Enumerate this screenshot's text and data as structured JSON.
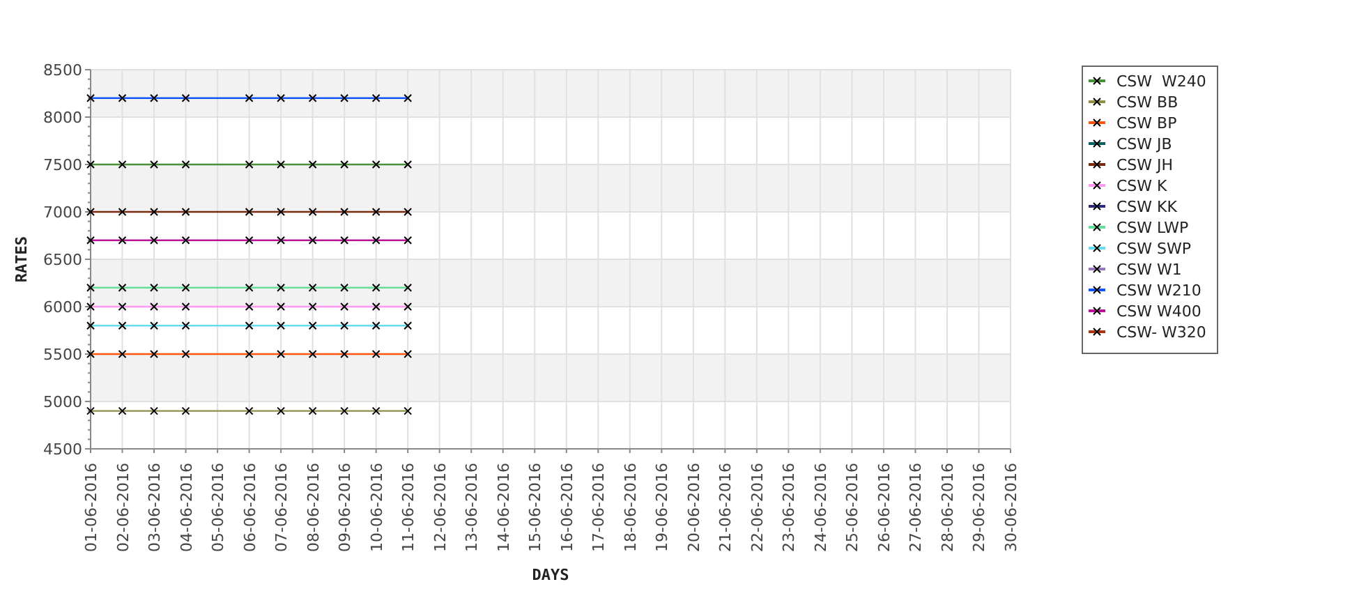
{
  "chart_data": {
    "type": "line",
    "xlabel": "DAYS",
    "ylabel": "RATES",
    "grid": true,
    "legend": true,
    "categories": [
      "01-06-2016",
      "02-06-2016",
      "03-06-2016",
      "04-06-2016",
      "05-06-2016",
      "06-06-2016",
      "07-06-2016",
      "08-06-2016",
      "09-06-2016",
      "10-06-2016",
      "11-06-2016",
      "12-06-2016",
      "13-06-2016",
      "14-06-2016",
      "15-06-2016",
      "16-06-2016",
      "17-06-2016",
      "18-06-2016",
      "19-06-2016",
      "20-06-2016",
      "21-06-2016",
      "22-06-2016",
      "23-06-2016",
      "24-06-2016",
      "25-06-2016",
      "26-06-2016",
      "27-06-2016",
      "28-06-2016",
      "29-06-2016",
      "30-06-2016"
    ],
    "ylim": [
      4500,
      8500
    ],
    "yticks": [
      4500,
      5000,
      5500,
      6000,
      6500,
      7000,
      7500,
      8000,
      8500
    ],
    "series": [
      {
        "name": "CSW  W240",
        "color": "#4a8f3a",
        "marker": "x",
        "values": [
          7500,
          7500,
          7500,
          7500,
          null,
          7500,
          7500,
          7500,
          7500,
          7500,
          7500,
          null,
          null,
          null,
          null,
          null,
          null,
          null,
          null,
          null,
          null,
          null,
          null,
          null,
          null,
          null,
          null,
          null,
          null,
          null
        ]
      },
      {
        "name": "CSW BB",
        "color": "#8f8f4a",
        "marker": "x",
        "values": [
          4900,
          4900,
          4900,
          4900,
          null,
          4900,
          4900,
          4900,
          4900,
          4900,
          4900,
          null,
          null,
          null,
          null,
          null,
          null,
          null,
          null,
          null,
          null,
          null,
          null,
          null,
          null,
          null,
          null,
          null,
          null,
          null
        ]
      },
      {
        "name": "CSW BP",
        "color": "#ff5511",
        "marker": "x",
        "values": [
          5500,
          5500,
          5500,
          5500,
          null,
          5500,
          5500,
          5500,
          5500,
          5500,
          5500,
          null,
          null,
          null,
          null,
          null,
          null,
          null,
          null,
          null,
          null,
          null,
          null,
          null,
          null,
          null,
          null,
          null,
          null,
          null
        ]
      },
      {
        "name": "CSW JB",
        "color": "#0a6060",
        "marker": "x",
        "values": [
          null,
          null,
          null,
          null,
          null,
          null,
          null,
          null,
          null,
          null,
          null,
          null,
          null,
          null,
          null,
          null,
          null,
          null,
          null,
          null,
          null,
          null,
          null,
          null,
          null,
          null,
          null,
          null,
          null,
          null
        ]
      },
      {
        "name": "CSW JH",
        "color": "#7a2a10",
        "marker": "x",
        "values": [
          7000,
          7000,
          7000,
          7000,
          null,
          7000,
          7000,
          7000,
          7000,
          7000,
          7000,
          null,
          null,
          null,
          null,
          null,
          null,
          null,
          null,
          null,
          null,
          null,
          null,
          null,
          null,
          null,
          null,
          null,
          null,
          null
        ]
      },
      {
        "name": "CSW K",
        "color": "#ff99ee",
        "marker": "x",
        "values": [
          6000,
          6000,
          6000,
          6000,
          null,
          6000,
          6000,
          6000,
          6000,
          6000,
          6000,
          null,
          null,
          null,
          null,
          null,
          null,
          null,
          null,
          null,
          null,
          null,
          null,
          null,
          null,
          null,
          null,
          null,
          null,
          null
        ]
      },
      {
        "name": "CSW KK",
        "color": "#2a2a7a",
        "marker": "x",
        "values": [
          null,
          null,
          null,
          null,
          null,
          null,
          null,
          null,
          null,
          null,
          null,
          null,
          null,
          null,
          null,
          null,
          null,
          null,
          null,
          null,
          null,
          null,
          null,
          null,
          null,
          null,
          null,
          null,
          null,
          null
        ]
      },
      {
        "name": "CSW LWP",
        "color": "#66dd99",
        "marker": "x",
        "values": [
          6200,
          6200,
          6200,
          6200,
          null,
          6200,
          6200,
          6200,
          6200,
          6200,
          6200,
          null,
          null,
          null,
          null,
          null,
          null,
          null,
          null,
          null,
          null,
          null,
          null,
          null,
          null,
          null,
          null,
          null,
          null,
          null
        ]
      },
      {
        "name": "CSW SWP",
        "color": "#66ddee",
        "marker": "x",
        "values": [
          5800,
          5800,
          5800,
          5800,
          null,
          5800,
          5800,
          5800,
          5800,
          5800,
          5800,
          null,
          null,
          null,
          null,
          null,
          null,
          null,
          null,
          null,
          null,
          null,
          null,
          null,
          null,
          null,
          null,
          null,
          null,
          null
        ]
      },
      {
        "name": "CSW W1",
        "color": "#9977bb",
        "marker": "x",
        "values": [
          null,
          null,
          null,
          null,
          null,
          null,
          null,
          null,
          null,
          null,
          null,
          null,
          null,
          null,
          null,
          null,
          null,
          null,
          null,
          null,
          null,
          null,
          null,
          null,
          null,
          null,
          null,
          null,
          null,
          null
        ]
      },
      {
        "name": "CSW W210",
        "color": "#1155ff",
        "marker": "x",
        "values": [
          8200,
          8200,
          8200,
          8200,
          null,
          8200,
          8200,
          8200,
          8200,
          8200,
          8200,
          null,
          null,
          null,
          null,
          null,
          null,
          null,
          null,
          null,
          null,
          null,
          null,
          null,
          null,
          null,
          null,
          null,
          null,
          null
        ]
      },
      {
        "name": "CSW W400",
        "color": "#bb1199",
        "marker": "x",
        "values": [
          6700,
          6700,
          6700,
          6700,
          null,
          6700,
          6700,
          6700,
          6700,
          6700,
          6700,
          null,
          null,
          null,
          null,
          null,
          null,
          null,
          null,
          null,
          null,
          null,
          null,
          null,
          null,
          null,
          null,
          null,
          null,
          null
        ]
      },
      {
        "name": "CSW- W320",
        "color": "#aa3311",
        "marker": "x",
        "values": [
          null,
          null,
          null,
          null,
          null,
          null,
          null,
          null,
          null,
          null,
          null,
          null,
          null,
          null,
          null,
          null,
          null,
          null,
          null,
          null,
          null,
          null,
          null,
          null,
          null,
          null,
          null,
          null,
          null,
          null
        ]
      }
    ]
  }
}
